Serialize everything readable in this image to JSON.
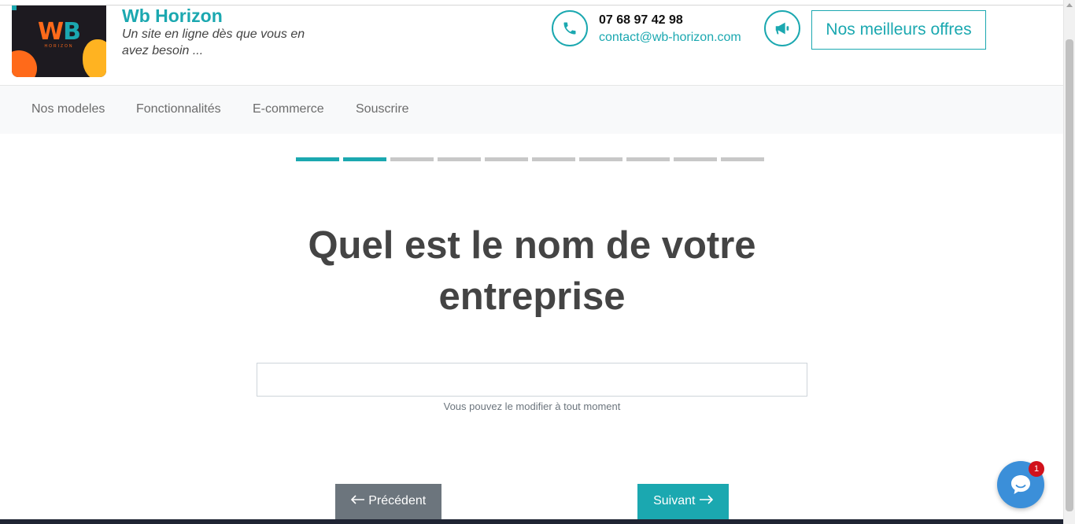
{
  "header": {
    "logo": {
      "letters_w": "W",
      "letters_b": "B",
      "sub": "HORIZON"
    },
    "brand_name": "Wb Horizon",
    "tagline": "Un site en ligne dès que vous en avez besoin ...",
    "phone": "07 68 97 42 98",
    "email": "contact@wb-horizon.com",
    "offers_label": "Nos meilleurs offres"
  },
  "nav": {
    "items": [
      {
        "label": "Nos modeles"
      },
      {
        "label": "Fonctionnalités"
      },
      {
        "label": "E-commerce"
      },
      {
        "label": "Souscrire"
      }
    ]
  },
  "progress": {
    "current_step": 2,
    "total_steps": 10
  },
  "form": {
    "question": "Quel est le nom de votre entreprise",
    "input_value": "",
    "help_text": "Vous pouvez le modifier à tout moment",
    "prev_label": "Précédent",
    "next_label": "Suivant"
  },
  "chat": {
    "badge_count": "1"
  },
  "colors": {
    "accent": "#1ba8b0",
    "secondary": "#6c757d",
    "chat": "#3b8fd9",
    "badge": "#d1111b"
  },
  "icons": {
    "phone": "phone-icon",
    "megaphone": "megaphone-icon",
    "arrow_left": "arrow-left-icon",
    "arrow_right": "arrow-right-icon",
    "chat": "chat-bubble-icon"
  }
}
